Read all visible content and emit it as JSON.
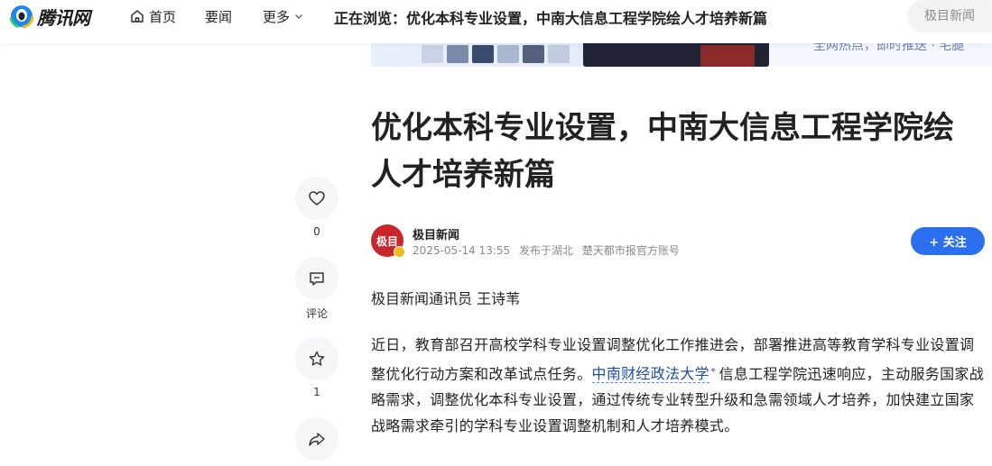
{
  "nav": {
    "logo_text": "腾讯网",
    "home_label": "首页",
    "yaowen_label": "要闻",
    "more_label": "更多",
    "browsing_text": "正在浏览：优化本科专业设置，中南大信息工程学院绘人才培养新篇",
    "search_placeholder": "极目新闻"
  },
  "banner": {
    "text": "全网热点，即时推送 · 宅腿"
  },
  "actions": {
    "like_count": "0",
    "comment_label": "评论",
    "favorite_count": "1",
    "share_label": "分享"
  },
  "article": {
    "title": "优化本科专业设置，中南大信息工程学院绘人才培养新篇",
    "author": {
      "avatar_text": "极目",
      "name": "极目新闻",
      "time": "2025-05-14 13:55",
      "location": "发布于湖北",
      "account": "楚天都市报官方账号"
    },
    "follow_label": "+ 关注",
    "byline": "极目新闻通讯员 王诗苇",
    "body": {
      "part1": "近日，教育部召开高校学科专业设置调整优化工作推进会，部署推进高等教育学科专业设置调整优化行动方案和改革试点任务。",
      "link": "中南财经政法大学",
      "part2": "信息工程学院迅速响应，主动服务国家战略需求，调整优化本科专业设置，通过传统专业转型升级和急需领域人才培养，加快建立国家战略需求牵引的学科专业设置调整机制和人才培养模式。"
    }
  },
  "colors": {
    "accent": "#2a6ff0",
    "avatar_bg": "#c9262c",
    "link": "#1d4ea8"
  },
  "icons": [
    "logo-icon",
    "home-icon",
    "chevron-down-icon",
    "heart-icon",
    "comment-icon",
    "star-icon",
    "share-icon",
    "verified-badge-icon"
  ]
}
